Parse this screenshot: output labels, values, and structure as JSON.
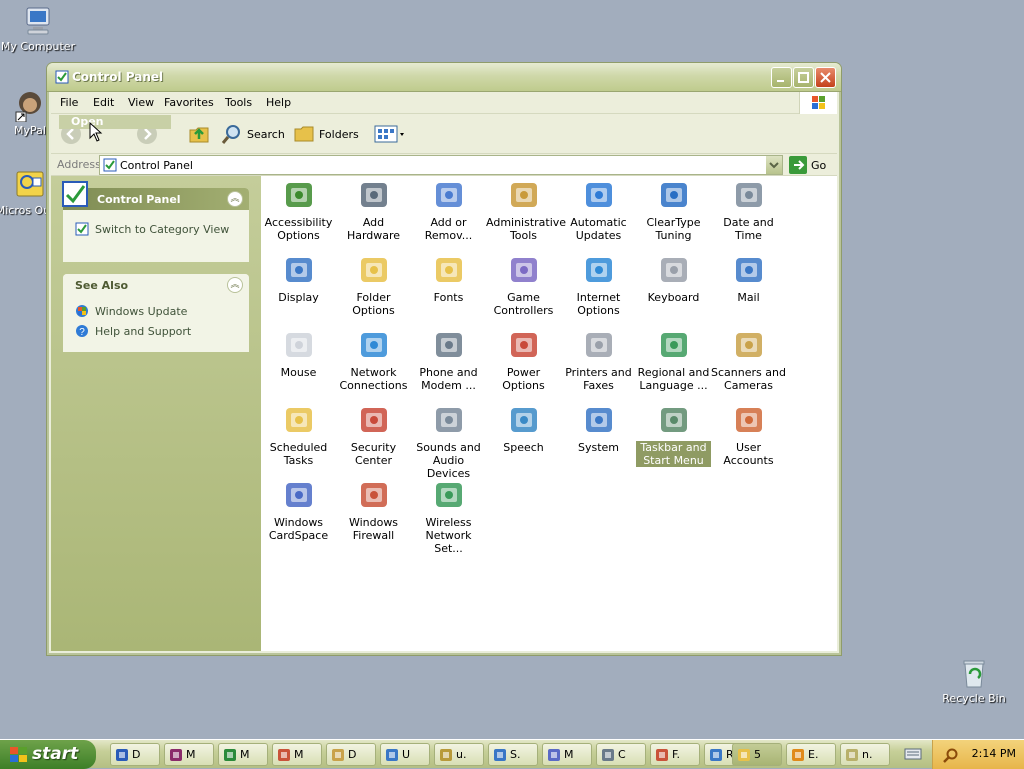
{
  "desktop": {
    "icons": [
      {
        "label": "My Computer"
      },
      {
        "label": "MyPal"
      },
      {
        "label": "Micros Outlo"
      },
      {
        "label": "Recycle Bin"
      }
    ]
  },
  "window": {
    "title": "Control Panel",
    "menu": [
      "File",
      "Edit",
      "View",
      "Favorites",
      "Tools",
      "Help"
    ],
    "toolbar": {
      "open_tooltip": "Open",
      "search_label": "Search",
      "folders_label": "Folders"
    },
    "address": {
      "label": "Address",
      "value": "Control Panel",
      "go_label": "Go"
    },
    "sidebar": {
      "panel1_title": "Control Panel",
      "switch_view": "Switch to Category View",
      "see_also_title": "See Also",
      "windows_update": "Windows Update",
      "help_support": "Help and Support"
    },
    "items": [
      {
        "label": "Accessibility Options",
        "icon": "accessibility-icon",
        "color": "#3b8a2d"
      },
      {
        "label": "Add Hardware",
        "icon": "hardware-icon",
        "color": "#5a6a7a"
      },
      {
        "label": "Add or Remov...",
        "icon": "programs-icon",
        "color": "#4a7bd0"
      },
      {
        "label": "Administrative Tools",
        "icon": "admin-tools-icon",
        "color": "#c99a3a"
      },
      {
        "label": "Automatic Updates",
        "icon": "updates-icon",
        "color": "#2f7bd6"
      },
      {
        "label": "ClearType Tuning",
        "icon": "cleartype-icon",
        "color": "#2a6fc4"
      },
      {
        "label": "Date and Time",
        "icon": "clock-icon",
        "color": "#7a8a9a"
      },
      {
        "label": "Display",
        "icon": "display-icon",
        "color": "#3a77c6"
      },
      {
        "label": "Folder Options",
        "icon": "folder-options-icon",
        "color": "#e7c14a"
      },
      {
        "label": "Fonts",
        "icon": "fonts-icon",
        "color": "#e7c14a"
      },
      {
        "label": "Game Controllers",
        "icon": "gamepad-icon",
        "color": "#7d6bc4"
      },
      {
        "label": "Internet Options",
        "icon": "internet-icon",
        "color": "#2f8ad6"
      },
      {
        "label": "Keyboard",
        "icon": "keyboard-icon",
        "color": "#9aa0aa"
      },
      {
        "label": "Mail",
        "icon": "mail-icon",
        "color": "#3a77c6"
      },
      {
        "label": "Mouse",
        "icon": "mouse-icon",
        "color": "#cfd3da"
      },
      {
        "label": "Network Connections",
        "icon": "network-icon",
        "color": "#2f8ad6"
      },
      {
        "label": "Phone and Modem ...",
        "icon": "phone-icon",
        "color": "#6a7a8a"
      },
      {
        "label": "Power Options",
        "icon": "power-icon",
        "color": "#c94a3a"
      },
      {
        "label": "Printers and Faxes",
        "icon": "printer-icon",
        "color": "#9aa0aa"
      },
      {
        "label": "Regional and Language ...",
        "icon": "globe-icon",
        "color": "#3a9a5a"
      },
      {
        "label": "Scanners and Cameras",
        "icon": "scanner-icon",
        "color": "#c9a24a"
      },
      {
        "label": "Scheduled Tasks",
        "icon": "scheduled-tasks-icon",
        "color": "#e7c14a"
      },
      {
        "label": "Security Center",
        "icon": "shield-icon",
        "color": "#c94a3a"
      },
      {
        "label": "Sounds and Audio Devices",
        "icon": "speaker-icon",
        "color": "#7a8a9a"
      },
      {
        "label": "Speech",
        "icon": "speech-icon",
        "color": "#3a8ac6"
      },
      {
        "label": "System",
        "icon": "system-icon",
        "color": "#3a77c6"
      },
      {
        "label": "Taskbar and Start Menu",
        "icon": "taskbar-icon",
        "color": "#5a8a6a"
      },
      {
        "label": "User Accounts",
        "icon": "users-icon",
        "color": "#d06a3a"
      },
      {
        "label": "Windows CardSpace",
        "icon": "cardspace-icon",
        "color": "#4a6ac6"
      },
      {
        "label": "Windows Firewall",
        "icon": "firewall-icon",
        "color": "#c9533a"
      },
      {
        "label": "Wireless Network Set...",
        "icon": "wireless-icon",
        "color": "#3a9a5a"
      }
    ]
  },
  "taskbar": {
    "start_label": "start",
    "tasks": [
      {
        "label": "D",
        "color": "#2a5bb8"
      },
      {
        "label": "M",
        "color": "#8a2a6a"
      },
      {
        "label": "M",
        "color": "#2a8a3a"
      },
      {
        "label": "M",
        "color": "#c9533a"
      },
      {
        "label": "D",
        "color": "#c9a24a"
      },
      {
        "label": "U",
        "color": "#3a77c6"
      },
      {
        "label": "u.",
        "color": "#b89a3a"
      },
      {
        "label": "S.",
        "color": "#3a77c6"
      },
      {
        "label": "M",
        "color": "#5a6ac6"
      },
      {
        "label": "C",
        "color": "#6a7a8a"
      },
      {
        "label": "F.",
        "color": "#c9533a"
      },
      {
        "label": "R",
        "color": "#3a77c6"
      },
      {
        "label": "5",
        "color": "#e7c14a"
      },
      {
        "label": "E.",
        "color": "#e08a1a"
      },
      {
        "label": "n.",
        "color": "#b8b06a"
      }
    ],
    "clock": "2:14 PM"
  }
}
